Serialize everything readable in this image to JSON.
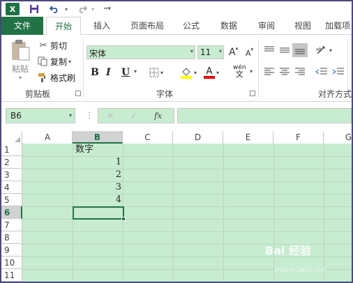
{
  "quick_access": {
    "logo": "X",
    "save_icon": "save-icon",
    "undo_icon": "undo-icon",
    "redo_icon": "redo-icon"
  },
  "tabs": [
    {
      "label": "文件"
    },
    {
      "label": "开始"
    },
    {
      "label": "插入"
    },
    {
      "label": "页面布局"
    },
    {
      "label": "公式"
    },
    {
      "label": "数据"
    },
    {
      "label": "审阅"
    },
    {
      "label": "视图"
    },
    {
      "label": "加载项"
    }
  ],
  "clipboard": {
    "paste_label": "粘贴",
    "cut_label": "剪切",
    "copy_label": "复制",
    "format_painter_label": "格式刷",
    "group_label": "剪贴板"
  },
  "font": {
    "name": "宋体",
    "size": "11",
    "grow": "A",
    "shrink": "A",
    "bold": "B",
    "italic": "I",
    "underline": "U",
    "font_color_glyph": "A",
    "phonetic_glyph": "wén",
    "phonetic_glyph2": "文",
    "group_label": "字体"
  },
  "alignment": {
    "group_label": "对齐方式"
  },
  "formula_bar": {
    "name_box": "B6",
    "fx": "fx",
    "cancel": "✕",
    "enter": "✓",
    "value": ""
  },
  "grid": {
    "columns": [
      "A",
      "B",
      "C",
      "D",
      "E",
      "F",
      "G"
    ],
    "rows": [
      "1",
      "2",
      "3",
      "4",
      "5",
      "6",
      "7",
      "8",
      "9",
      "10",
      "11"
    ],
    "selected_cell": "B6",
    "cells": {
      "B1": "数字",
      "B2": "1",
      "B3": "2",
      "B4": "3",
      "B5": "4"
    }
  },
  "watermark": {
    "text": "Bai 经验",
    "sub": "jingyan.baidu.com"
  },
  "colors": {
    "accent": "#217346",
    "sheet_bg": "#c7ecd0"
  }
}
